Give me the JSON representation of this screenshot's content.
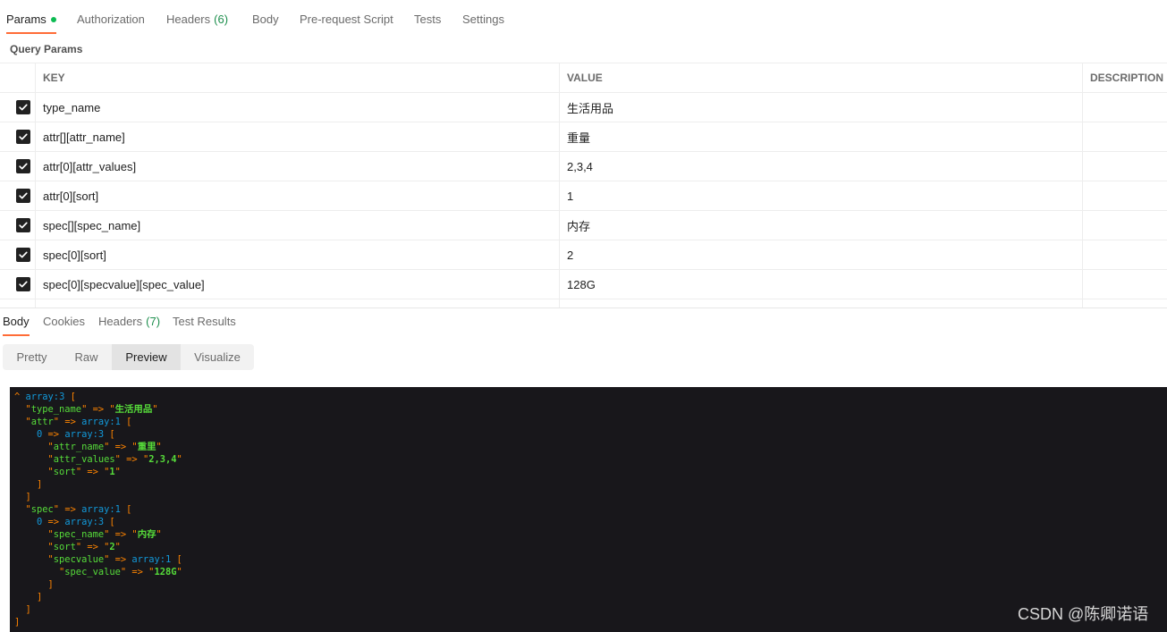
{
  "request": {
    "tabs": [
      {
        "label": "Params",
        "active": true
      },
      {
        "label": "Authorization"
      },
      {
        "label": "Headers",
        "count": "(6)"
      },
      {
        "label": "Body"
      },
      {
        "label": "Pre-request Script"
      },
      {
        "label": "Tests"
      },
      {
        "label": "Settings"
      }
    ],
    "section_title": "Query Params",
    "params_table": {
      "columns": [
        "KEY",
        "VALUE",
        "DESCRIPTION"
      ],
      "rows": [
        {
          "checked": true,
          "key": "type_name",
          "value": "生活用品",
          "description": ""
        },
        {
          "checked": true,
          "key": "attr[][attr_name]",
          "value": "重量",
          "description": ""
        },
        {
          "checked": true,
          "key": "attr[0][attr_values]",
          "value": "2,3,4",
          "description": ""
        },
        {
          "checked": true,
          "key": "attr[0][sort]",
          "value": "1",
          "description": ""
        },
        {
          "checked": true,
          "key": "spec[][spec_name]",
          "value": "内存",
          "description": ""
        },
        {
          "checked": true,
          "key": "spec[0][sort]",
          "value": "2",
          "description": ""
        },
        {
          "checked": true,
          "key": "spec[0][specvalue][spec_value]",
          "value": "128G",
          "description": ""
        }
      ]
    }
  },
  "response": {
    "tabs": [
      {
        "label": "Body",
        "active": true
      },
      {
        "label": "Cookies"
      },
      {
        "label": "Headers",
        "count": "(7)"
      },
      {
        "label": "Test Results"
      }
    ],
    "view_modes": [
      {
        "label": "Pretty"
      },
      {
        "label": "Raw"
      },
      {
        "label": "Preview",
        "active": true
      },
      {
        "label": "Visualize"
      }
    ],
    "dump": {
      "caret": "^",
      "syntax": {
        "quote": "\"",
        "arrow": "=>",
        "open": "[",
        "close": "]"
      },
      "root": {
        "note": "array:3",
        "entries": [
          {
            "key": "type_name",
            "value": "生活用品"
          },
          {
            "key": "attr",
            "value": {
              "note": "array:1",
              "entries": [
                {
                  "index": "0",
                  "value": {
                    "note": "array:3",
                    "entries": [
                      {
                        "key": "attr_name",
                        "value": "重里"
                      },
                      {
                        "key": "attr_values",
                        "value": "2,3,4"
                      },
                      {
                        "key": "sort",
                        "value": "1"
                      }
                    ]
                  }
                }
              ]
            }
          },
          {
            "key": "spec",
            "value": {
              "note": "array:1",
              "entries": [
                {
                  "index": "0",
                  "value": {
                    "note": "array:3",
                    "entries": [
                      {
                        "key": "spec_name",
                        "value": "内存"
                      },
                      {
                        "key": "sort",
                        "value": "2"
                      },
                      {
                        "key": "specvalue",
                        "value": {
                          "note": "array:1",
                          "entries": [
                            {
                              "key": "spec_value",
                              "value": "128G"
                            }
                          ]
                        }
                      }
                    ]
                  }
                }
              ]
            }
          }
        ]
      }
    }
  },
  "watermark": "CSDN @陈卿诺语",
  "colors": {
    "accent": "#ff6c37",
    "active_dot": "#0cbb52",
    "count": "#1e8f4e",
    "checkbox": "#212121",
    "dump_background": "#18171b",
    "dump_default": "#ff8400",
    "dump_note": "#1299da",
    "dump_key": "#56db3a",
    "dump_string": "#56db3a"
  }
}
